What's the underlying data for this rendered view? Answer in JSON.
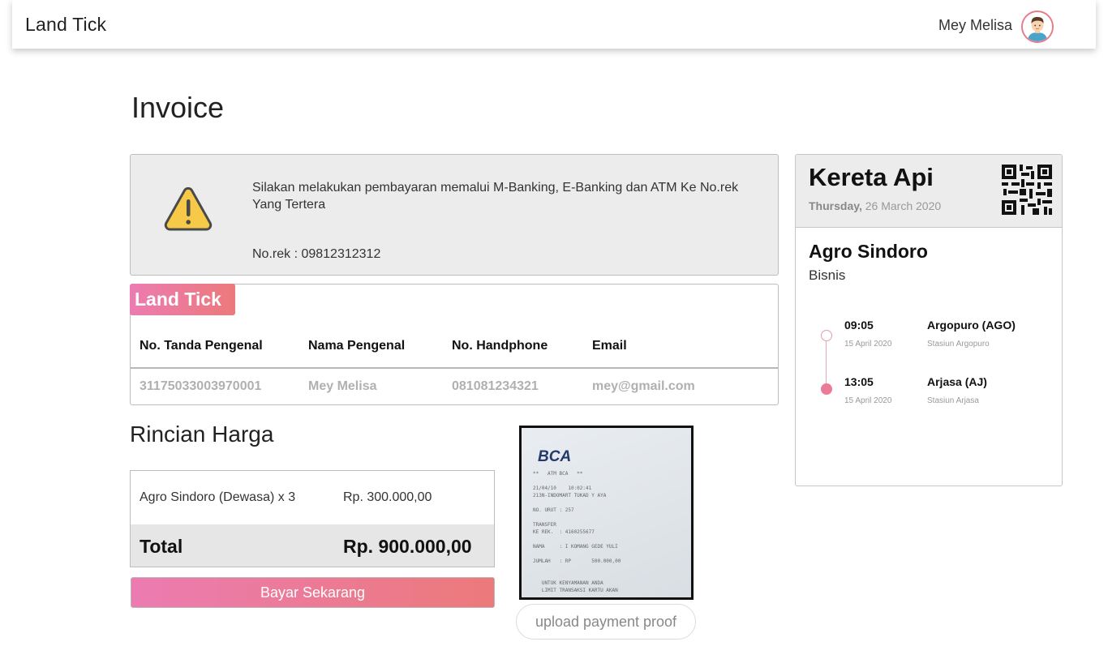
{
  "navbar": {
    "brand": "Land Tick",
    "user_name": "Mey Melisa"
  },
  "page": {
    "title": "Invoice"
  },
  "notice": {
    "message": "Silakan melakukan pembayaran memalui M-Banking, E-Banking dan ATM Ke No.rek Yang Tertera",
    "account": "No.rek : 09812312312"
  },
  "passenger": {
    "tag": "Land Tick",
    "headers": [
      "No. Tanda Pengenal",
      "Nama Pengenal",
      "No. Handphone",
      "Email"
    ],
    "row": [
      "31175033003970001",
      "Mey Melisa",
      "081081234321",
      "mey@gmail.com"
    ]
  },
  "pricing": {
    "title": "Rincian Harga",
    "item_label": "Agro Sindoro (Dewasa) x 3",
    "item_price": "Rp. 300.000,00",
    "total_label": "Total",
    "total_value": "Rp. 900.000,00",
    "pay_button": "Bayar Sekarang"
  },
  "proof": {
    "upload_button": "upload payment proof",
    "receipt_logo": "BCA",
    "receipt_text": "**   ATM BCA   **\n\n21/04/10    10:02:41\n213N-INDOMART TUKAD Y AYA\n\nNO. URUT : 257\n\nTRANSFER\nKE REK.  : 4160255677\n\nNAMA     : I KOMANG GEDE YULI\n\nJUMLAH   : RP       500.000,00\n\n\n   UNTUK KENYAMANAN ANDA\n   LIMIT TRANSAKSI KARTU AKAN"
  },
  "ticket": {
    "title": "Kereta Api",
    "day": "Thursday,",
    "date": "26 March 2020",
    "train_name": "Agro Sindoro",
    "train_class": "Bisnis",
    "departure": {
      "time": "09:05",
      "date": "15 April 2020",
      "station": "Argopuro (AGO)",
      "station_sub": "Stasiun Argopuro"
    },
    "arrival": {
      "time": "13:05",
      "date": "15 April 2020",
      "station": "Arjasa (AJ)",
      "station_sub": "Stasiun Arjasa"
    }
  },
  "colors": {
    "accent_start": "#ec7bb2",
    "accent_end": "#ec7a7a",
    "panel_bg": "#ececec",
    "warning": "#f7c948"
  },
  "icons": {
    "warning": "warning-triangle-icon",
    "qr": "qr-code-icon",
    "avatar": "user-avatar"
  }
}
